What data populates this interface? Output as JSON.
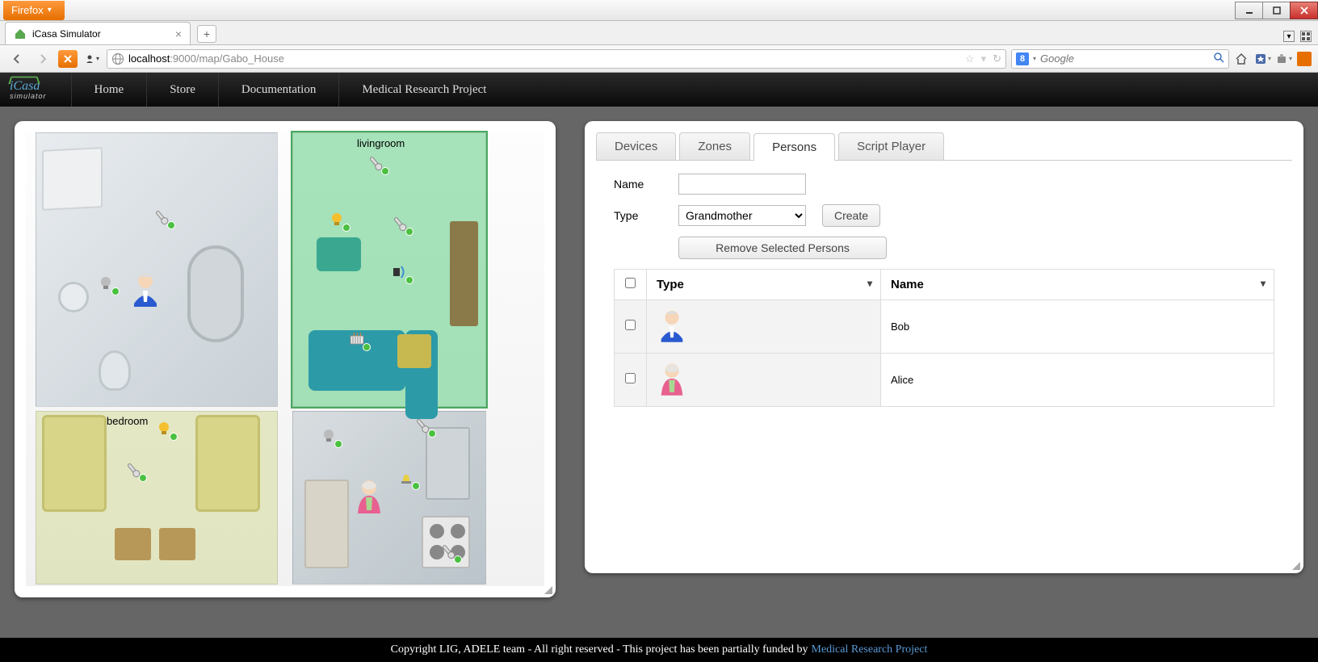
{
  "browser": {
    "menu_button": "Firefox",
    "tab_title": "iCasa Simulator",
    "url_host": "localhost",
    "url_port_path": ":9000/map/Gabo_House",
    "search_placeholder": "Google"
  },
  "app_nav": {
    "logo_main": "iCasa",
    "logo_sub": "simulator",
    "items": [
      "Home",
      "Store",
      "Documentation",
      "Medical Research Project"
    ]
  },
  "floorplan": {
    "zones": {
      "livingroom": "livingroom",
      "bedroom": "bedroom"
    }
  },
  "right_panel": {
    "tabs": [
      "Devices",
      "Zones",
      "Persons",
      "Script Player"
    ],
    "active_tab": "Persons",
    "form": {
      "name_label": "Name",
      "name_value": "",
      "type_label": "Type",
      "type_selected": "Grandmother",
      "create_btn": "Create",
      "remove_btn": "Remove Selected Persons"
    },
    "table": {
      "headers": {
        "type": "Type",
        "name": "Name"
      },
      "rows": [
        {
          "type_icon": "grandfather",
          "name": "Bob"
        },
        {
          "type_icon": "grandmother",
          "name": "Alice"
        }
      ]
    }
  },
  "footer": {
    "text": "Copyright LIG, ADELE team - All right reserved - This project has been partially funded by ",
    "link": "Medical Research Project"
  }
}
